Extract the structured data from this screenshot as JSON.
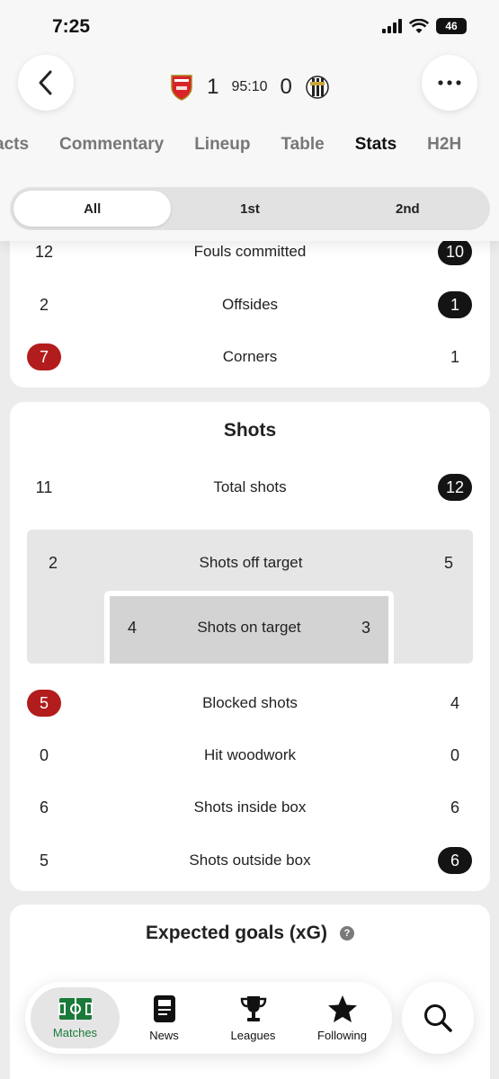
{
  "status_bar": {
    "time": "7:25",
    "battery": "46"
  },
  "match": {
    "home_score": "1",
    "away_score": "0",
    "clock": "95:10"
  },
  "tabs": [
    {
      "label": "acts"
    },
    {
      "label": "Commentary"
    },
    {
      "label": "Lineup"
    },
    {
      "label": "Table"
    },
    {
      "label": "Stats"
    },
    {
      "label": "H2H"
    }
  ],
  "periods": [
    "All",
    "1st",
    "2nd"
  ],
  "top_stats": [
    {
      "label": "Fouls committed",
      "home": "12",
      "away": "10"
    },
    {
      "label": "Offsides",
      "home": "2",
      "away": "1"
    },
    {
      "label": "Corners",
      "home": "7",
      "away": "1"
    }
  ],
  "shots": {
    "title": "Shots",
    "total": {
      "label": "Total shots",
      "home": "11",
      "away": "12"
    },
    "off_target": {
      "label": "Shots off target",
      "home": "2",
      "away": "5"
    },
    "on_target": {
      "label": "Shots on target",
      "home": "4",
      "away": "3"
    },
    "rows": [
      {
        "label": "Blocked shots",
        "home": "5",
        "away": "4"
      },
      {
        "label": "Hit woodwork",
        "home": "0",
        "away": "0"
      },
      {
        "label": "Shots inside box",
        "home": "6",
        "away": "6"
      },
      {
        "label": "Shots outside box",
        "home": "5",
        "away": "6"
      }
    ]
  },
  "xg": {
    "title": "Expected goals (xG)",
    "help": "?"
  },
  "nav": [
    {
      "label": "Matches",
      "icon": "pitch-icon"
    },
    {
      "label": "News",
      "icon": "news-icon"
    },
    {
      "label": "Leagues",
      "icon": "trophy-icon"
    },
    {
      "label": "Following",
      "icon": "star-icon"
    }
  ],
  "colors": {
    "home_highlight": "#b21c1c",
    "away_highlight": "#141414",
    "active_nav": "#1a7a3a"
  }
}
